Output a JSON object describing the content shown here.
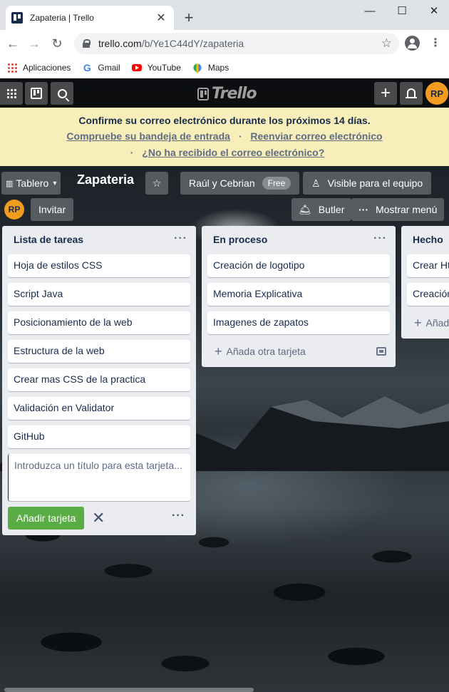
{
  "browser": {
    "tab_title": "Zapateria | Trello",
    "url_host": "trello.com",
    "url_path": "/b/Ye1C44dY/zapateria",
    "bookmarks": [
      "Aplicaciones",
      "Gmail",
      "YouTube",
      "Maps"
    ]
  },
  "header": {
    "logo_text": "Trello",
    "avatar_initials": "RP"
  },
  "banner": {
    "message": "Confirme su correo electrónico durante los próximos 14 días.",
    "link_inbox": "Compruebe su bandeja de entrada",
    "link_resend": "Reenviar correo electrónico",
    "link_not_received": "¿No ha recibido el correo electrónico?",
    "separator": "·"
  },
  "board": {
    "view_label": "Tablero",
    "title": "Zapateria",
    "team_name": "Raúl y Cebrian",
    "team_badge": "Free",
    "visibility": "Visible para el equipo",
    "member_initials": "RP",
    "invite_label": "Invitar",
    "butler_label": "Butler",
    "menu_label": "Mostrar menú"
  },
  "lists": [
    {
      "title": "Lista de tareas",
      "cards": [
        "Hoja de estilos CSS",
        "Script Java",
        "Posicionamiento de la web",
        "Estructura de la web",
        "Crear mas CSS de la practica",
        "Validación en Validator",
        "GitHub"
      ],
      "composer_placeholder": "Introduzca un título para esta tarjeta...",
      "add_card_label": "Añadir tarjeta"
    },
    {
      "title": "En proceso",
      "cards": [
        "Creación de logotipo",
        "Memoria Explicativa",
        "Imagenes de zapatos"
      ],
      "add_another_label": "Añada otra tarjeta"
    },
    {
      "title": "Hecho",
      "cards": [
        "Crear Html",
        "Creación"
      ],
      "add_another_label": "Añada"
    }
  ],
  "colors": {
    "banner": "#f8eeb9",
    "add_button": "#5aac44",
    "avatar": "#f29c1f"
  }
}
